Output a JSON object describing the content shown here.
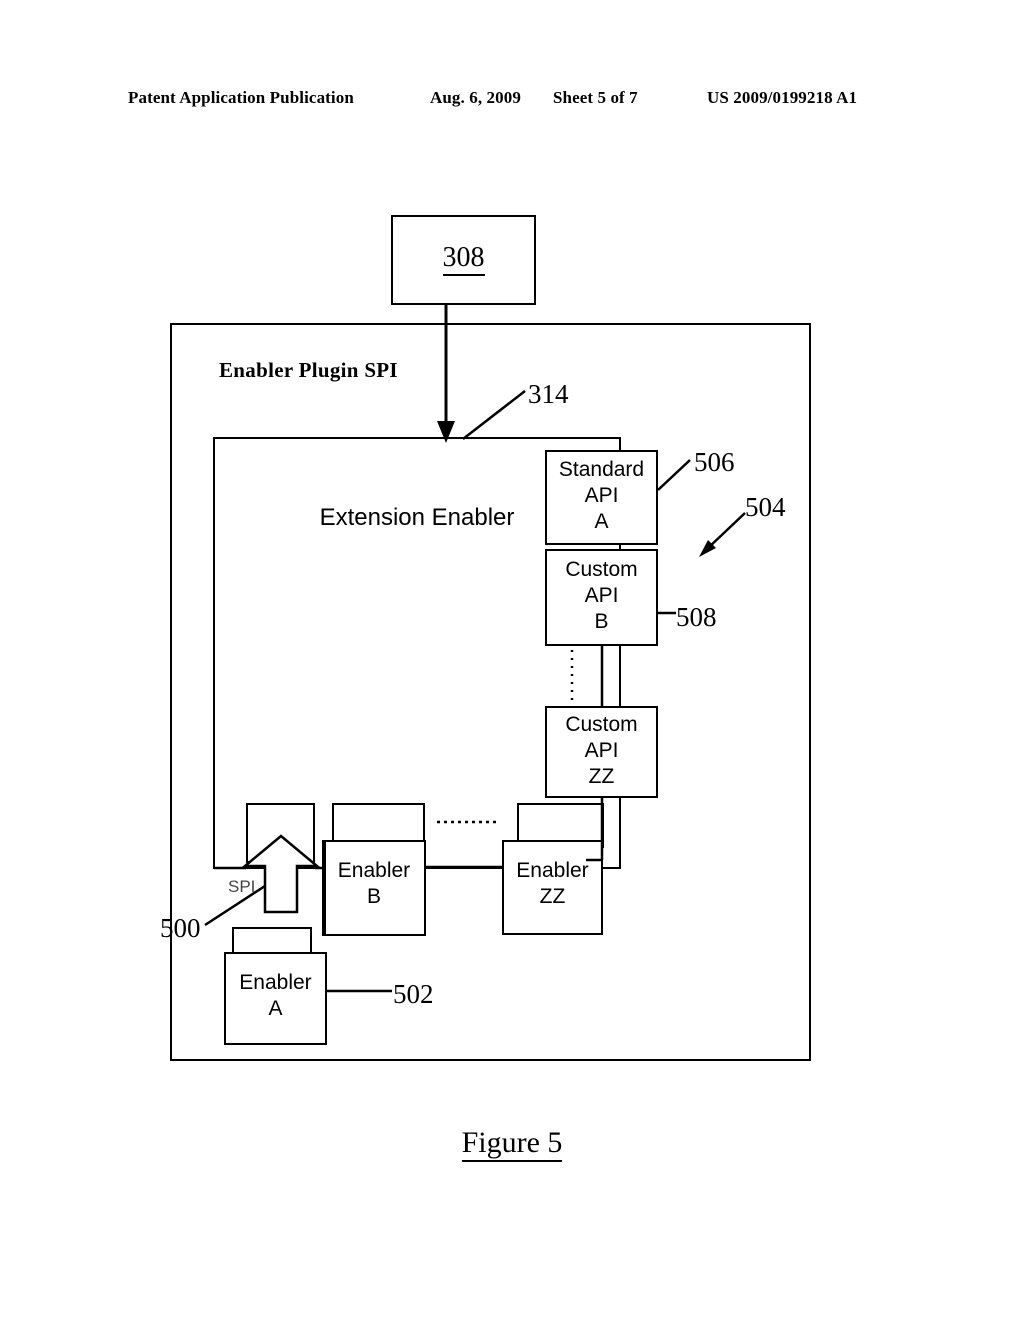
{
  "header": {
    "publication": "Patent Application Publication",
    "date": "Aug. 6, 2009",
    "sheet": "Sheet 5 of 7",
    "number": "US 2009/0199218 A1"
  },
  "figure": {
    "caption": "Figure 5"
  },
  "diagram": {
    "top_box": {
      "label": "308"
    },
    "container": {
      "title": "Enabler Plugin SPI"
    },
    "extension_enabler": {
      "label": "Extension Enabler"
    },
    "apis": [
      {
        "name": "standard-api-a",
        "label": "Standard\nAPI\nA",
        "ref": "506"
      },
      {
        "name": "custom-api-b",
        "label": "Custom\nAPI\nB",
        "ref": "508"
      },
      {
        "name": "custom-api-zz",
        "label": "Custom\nAPI\nZZ",
        "ref": ""
      }
    ],
    "enablers": [
      {
        "name": "enabler-a",
        "label": "Enabler\nA",
        "ref": "502"
      },
      {
        "name": "enabler-b",
        "label": "Enabler\nB",
        "ref": ""
      },
      {
        "name": "enabler-zz",
        "label": "Enabler\nZZ",
        "ref": ""
      }
    ],
    "spi_arrow": {
      "label": "SPI",
      "ref": "500"
    },
    "refs": {
      "r314": "314",
      "r504": "504",
      "r506": "506",
      "r508": "508",
      "r500": "500",
      "r502": "502"
    },
    "colors": {
      "stroke": "#000000",
      "background": "#ffffff"
    }
  }
}
